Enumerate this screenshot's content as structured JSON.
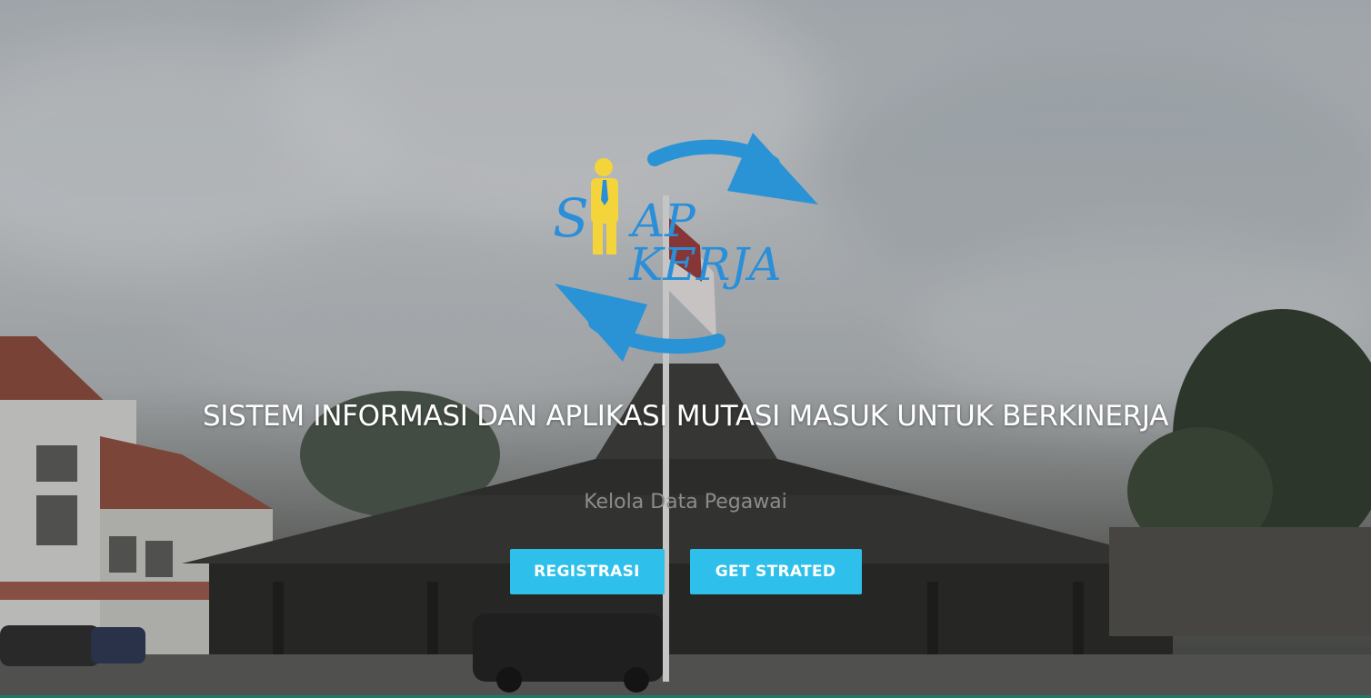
{
  "logo": {
    "text_line1": "SIAP",
    "text_line2": "KERJA",
    "colors": {
      "arrow": "#2a93d5",
      "figure": "#f4d43b",
      "text": "#2a8fd8"
    }
  },
  "hero": {
    "headline": "SISTEM INFORMASI DAN APLIKASI MUTASI MASUK UNTUK BERKINERJA",
    "subtitle": "Kelola Data Pegawai"
  },
  "actions": {
    "register_label": "REGISTRASI",
    "start_label": "GET STRATED"
  },
  "colors": {
    "button": "#2ec0ea",
    "headline": "#ffffff"
  }
}
